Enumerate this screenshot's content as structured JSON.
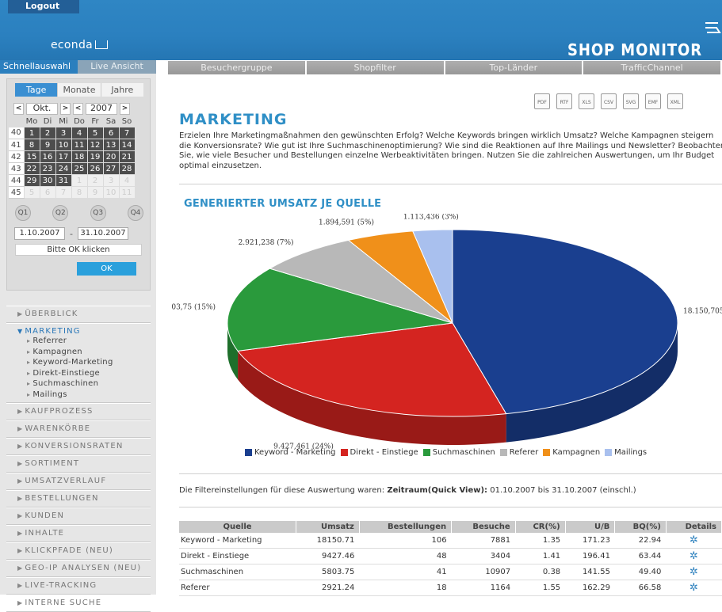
{
  "header": {
    "logout": "Logout",
    "logo": "econda",
    "product": "SHOP MONITOR"
  },
  "left_tabs": [
    "Schnellauswahl",
    "Live Ansicht"
  ],
  "period_tabs": [
    "Tage",
    "Monate",
    "Jahre"
  ],
  "calendar": {
    "month": "Okt.",
    "year": "2007",
    "weekdays": [
      "Mo",
      "Di",
      "Mi",
      "Do",
      "Fr",
      "Sa",
      "So"
    ],
    "weeks": [
      {
        "wk": "40",
        "days": [
          "1",
          "2",
          "3",
          "4",
          "5",
          "6",
          "7"
        ],
        "current": [
          true,
          true,
          true,
          true,
          true,
          true,
          true
        ]
      },
      {
        "wk": "41",
        "days": [
          "8",
          "9",
          "10",
          "11",
          "12",
          "13",
          "14"
        ],
        "current": [
          true,
          true,
          true,
          true,
          true,
          true,
          true
        ]
      },
      {
        "wk": "42",
        "days": [
          "15",
          "16",
          "17",
          "18",
          "19",
          "20",
          "21"
        ],
        "current": [
          true,
          true,
          true,
          true,
          true,
          true,
          true
        ]
      },
      {
        "wk": "43",
        "days": [
          "22",
          "23",
          "24",
          "25",
          "26",
          "27",
          "28"
        ],
        "current": [
          true,
          true,
          true,
          true,
          true,
          true,
          true
        ]
      },
      {
        "wk": "44",
        "days": [
          "29",
          "30",
          "31",
          "1",
          "2",
          "3",
          "4"
        ],
        "current": [
          true,
          true,
          true,
          false,
          false,
          false,
          false
        ]
      },
      {
        "wk": "45",
        "days": [
          "5",
          "6",
          "7",
          "8",
          "9",
          "10",
          "11"
        ],
        "current": [
          false,
          false,
          false,
          false,
          false,
          false,
          false
        ]
      }
    ],
    "quarters": [
      "Q1",
      "Q2",
      "Q3",
      "Q4"
    ],
    "from": "1.10.2007",
    "to": "31.10.2007",
    "dash": "-",
    "hint": "Bitte OK klicken",
    "ok": "OK"
  },
  "nav": {
    "before": [
      "ÜBERBLICK"
    ],
    "active": "MARKETING",
    "sub": [
      "Referrer",
      "Kampagnen",
      "Keyword-Marketing",
      "Direkt-Einstiege",
      "Suchmaschinen",
      "Mailings"
    ],
    "after": [
      "KAUFPROZESS",
      "WARENKÖRBE",
      "KONVERSIONSRATEN",
      "SORTIMENT",
      "UMSATZVERLAUF",
      "BESTELLUNGEN",
      "KUNDEN",
      "INHALTE",
      "KLICKPFADE (NEU)",
      "GEO-IP ANALYSEN (NEU)",
      "LIVE-TRACKING",
      "INTERNE SUCHE"
    ]
  },
  "filter_bar": [
    "Besuchergruppe",
    "Shopfilter",
    "Top-Länder",
    "TrafficChannel"
  ],
  "exports": [
    "PDF",
    "RTF",
    "XLS",
    "CSV",
    "SVG",
    "EMF",
    "XML"
  ],
  "main": {
    "title": "MARKETING",
    "intro": "Erzielen Ihre Marketingmaßnahmen den gewünschten Erfolg? Welche Keywords bringen wirklich Umsatz? Welche Kampagnen steigern die Konversionsrate? Wie gut ist Ihre Suchmaschinenoptimierung? Wie sind die Reaktionen auf Ihre Mailings und Newsletter? Beobachten Sie, wie viele Besucher und Bestellungen einzelne Werbeaktivitäten bringen. Nutzen Sie die zahlreichen Auswertungen, um Ihr Budget optimal einzusetzen.",
    "chart_title": "GENERIERTER UMSATZ JE QUELLE",
    "filter_prefix": "Die Filtereinstellungen für diese Auswertung waren: ",
    "filter_key": "Zeitraum(Quick View):",
    "filter_value": " 01.10.2007 bis 31.10.2007 (einschl.)"
  },
  "chart_data": {
    "type": "pie",
    "title": "GENERIERTER UMSATZ JE QUELLE",
    "slices": [
      {
        "name": "Keyword - Marketing",
        "value": 18150.71,
        "label": "18.150,705",
        "color": "#1a3f8f"
      },
      {
        "name": "Direkt - Einstiege",
        "value": 9427.46,
        "label": "9.427,461 (24%)",
        "color": "#d42420"
      },
      {
        "name": "Suchmaschinen",
        "value": 5803.75,
        "label": "03,75 (15%)",
        "color": "#2a9a3c"
      },
      {
        "name": "Referer",
        "value": 2921.24,
        "label": "2.921,238 (7%)",
        "color": "#b8b8b8"
      },
      {
        "name": "Kampagnen",
        "value": 1894.59,
        "label": "1.894,591 (5%)",
        "color": "#f0901a"
      },
      {
        "name": "Mailings",
        "value": 1113.44,
        "label": "1.113,436 (3%)",
        "color": "#a9c0ee"
      }
    ],
    "legend_position": "bottom"
  },
  "table": {
    "headers": [
      "Quelle",
      "Umsatz",
      "Bestellungen",
      "Besuche",
      "CR(%)",
      "U/B",
      "BQ(%)",
      "Details"
    ],
    "rows": [
      [
        "Keyword - Marketing",
        "18150.71",
        "106",
        "7881",
        "1.35",
        "171.23",
        "22.94",
        "✲"
      ],
      [
        "Direkt - Einstiege",
        "9427.46",
        "48",
        "3404",
        "1.41",
        "196.41",
        "63.44",
        "✲"
      ],
      [
        "Suchmaschinen",
        "5803.75",
        "41",
        "10907",
        "0.38",
        "141.55",
        "49.40",
        "✲"
      ],
      [
        "Referer",
        "2921.24",
        "18",
        "1164",
        "1.55",
        "162.29",
        "66.58",
        "✲"
      ]
    ]
  }
}
